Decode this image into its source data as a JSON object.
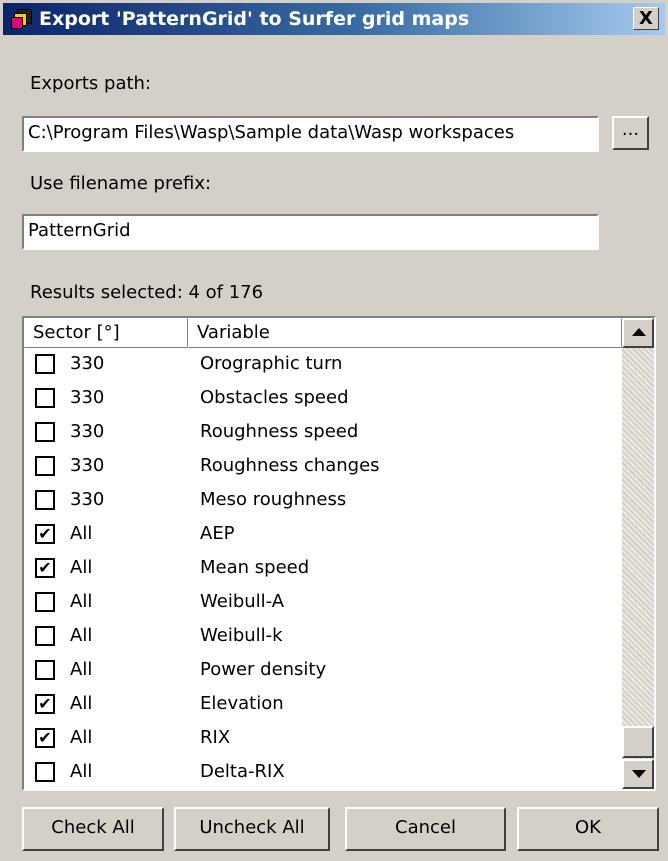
{
  "window": {
    "title": "Export 'PatternGrid' to Surfer grid maps",
    "close_label": "X",
    "icon": "app-icon"
  },
  "exports_path": {
    "label": "Exports path:",
    "value": "C:\\Program Files\\Wasp\\Sample data\\Wasp workspaces",
    "browse_label": "..."
  },
  "prefix": {
    "label": "Use filename prefix:",
    "value": "PatternGrid"
  },
  "results": {
    "label": "Results selected: 4 of 176"
  },
  "list": {
    "columns": [
      "Sector [°]",
      "Variable"
    ],
    "rows": [
      {
        "checked": false,
        "sector": "330",
        "variable": "Orographic turn"
      },
      {
        "checked": false,
        "sector": "330",
        "variable": "Obstacles speed"
      },
      {
        "checked": false,
        "sector": "330",
        "variable": "Roughness speed"
      },
      {
        "checked": false,
        "sector": "330",
        "variable": "Roughness changes"
      },
      {
        "checked": false,
        "sector": "330",
        "variable": "Meso roughness"
      },
      {
        "checked": true,
        "sector": "All",
        "variable": "AEP"
      },
      {
        "checked": true,
        "sector": "All",
        "variable": "Mean speed"
      },
      {
        "checked": false,
        "sector": "All",
        "variable": "Weibull-A"
      },
      {
        "checked": false,
        "sector": "All",
        "variable": "Weibull-k"
      },
      {
        "checked": false,
        "sector": "All",
        "variable": "Power density"
      },
      {
        "checked": true,
        "sector": "All",
        "variable": "Elevation"
      },
      {
        "checked": true,
        "sector": "All",
        "variable": "RIX"
      },
      {
        "checked": false,
        "sector": "All",
        "variable": "Delta-RIX"
      }
    ]
  },
  "buttons": {
    "check_all": "Check All",
    "uncheck_all": "Uncheck All",
    "cancel": "Cancel",
    "ok": "OK"
  }
}
